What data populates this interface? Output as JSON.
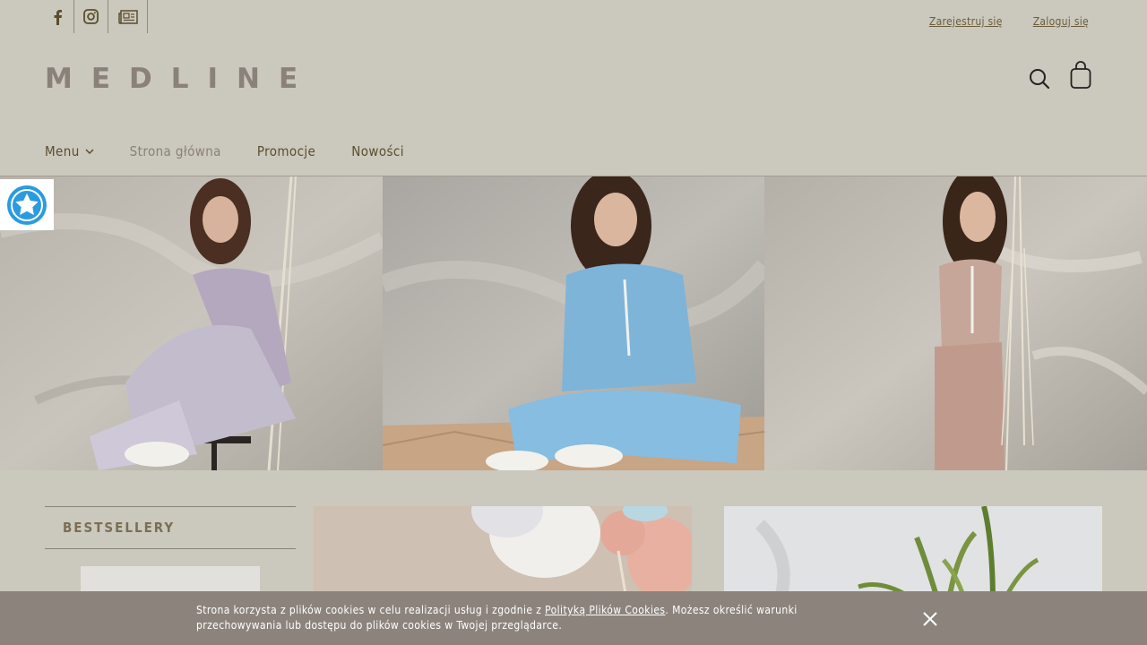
{
  "social": {
    "items": [
      {
        "icon": "facebook-icon"
      },
      {
        "icon": "instagram-icon"
      },
      {
        "icon": "newsletter-icon"
      }
    ]
  },
  "account": {
    "register": "Zarejestruj się",
    "login": "Zaloguj się"
  },
  "brand": {
    "logo": "MEDLINE"
  },
  "header": {
    "search_icon": "search-icon",
    "cart_icon": "cart-bag-icon"
  },
  "nav": {
    "menu": "Menu",
    "home": "Strona główna",
    "promotions": "Promocje",
    "new": "Nowości"
  },
  "sections": {
    "bestsellers": "BESTSELLERY"
  },
  "cookie": {
    "text_before": "Strona korzysta z plików cookies w celu realizacji usług i zgodnie z ",
    "link": "Polityką Plików Cookies",
    "text_after": ". Możesz określić warunki przechowywania lub dostępu do plików cookies w Twojej przeglądarce."
  },
  "colors": {
    "background": "#cbc8bd",
    "cookie_bar": "#8c847c",
    "logo": "#8a817a",
    "text": "#5a4e2e",
    "badge_star": "#2b9be0"
  }
}
